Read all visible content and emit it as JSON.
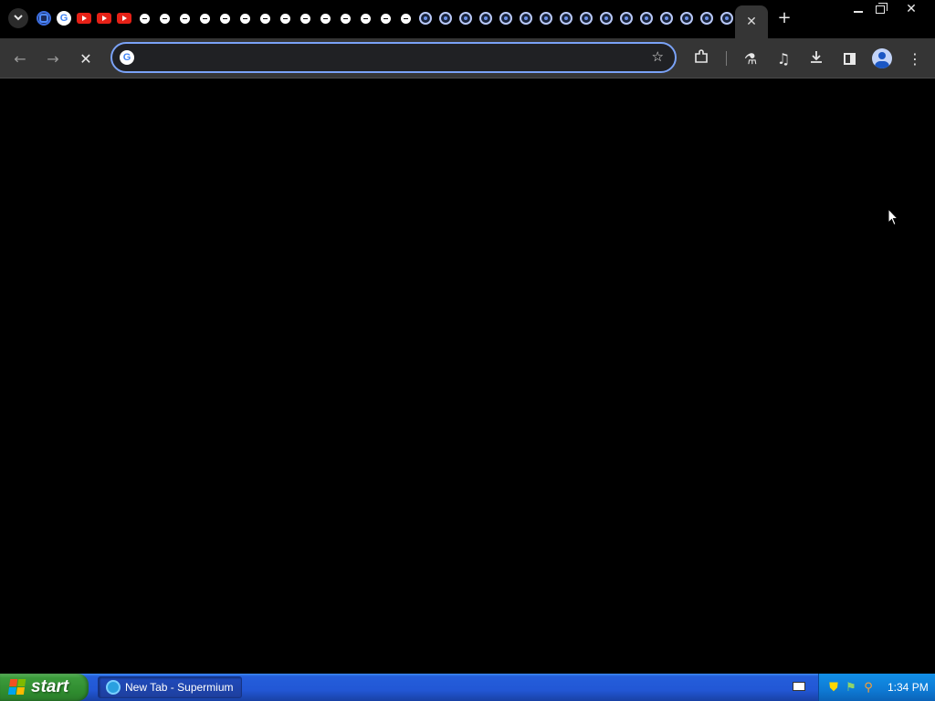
{
  "browser": {
    "tabs": [
      {
        "icon": "edge-icon"
      },
      {
        "icon": "google-icon"
      },
      {
        "icon": "youtube-icon"
      },
      {
        "icon": "youtube-icon"
      },
      {
        "icon": "youtube-icon"
      },
      {
        "icon": "globe-icon"
      },
      {
        "icon": "globe-icon"
      },
      {
        "icon": "globe-icon"
      },
      {
        "icon": "globe-icon"
      },
      {
        "icon": "globe-icon"
      },
      {
        "icon": "globe-icon"
      },
      {
        "icon": "globe-icon"
      },
      {
        "icon": "globe-icon"
      },
      {
        "icon": "globe-icon"
      },
      {
        "icon": "globe-icon"
      },
      {
        "icon": "globe-icon"
      },
      {
        "icon": "globe-icon"
      },
      {
        "icon": "globe-icon"
      },
      {
        "icon": "globe-icon"
      },
      {
        "icon": "ring-icon"
      },
      {
        "icon": "ring-icon"
      },
      {
        "icon": "ring-icon"
      },
      {
        "icon": "ring-icon"
      },
      {
        "icon": "ring-icon"
      },
      {
        "icon": "ring-icon"
      },
      {
        "icon": "ring-icon"
      },
      {
        "icon": "ring-icon"
      },
      {
        "icon": "ring-icon"
      },
      {
        "icon": "ring-icon"
      },
      {
        "icon": "ring-icon"
      },
      {
        "icon": "ring-icon"
      },
      {
        "icon": "ring-icon"
      },
      {
        "icon": "ring-icon"
      },
      {
        "icon": "ring-icon"
      },
      {
        "icon": "ring-icon"
      }
    ],
    "active_tab": {
      "close_glyph": "✕"
    },
    "new_tab_glyph": "+",
    "omnibox": {
      "value": "",
      "placeholder": "",
      "search_engine_glyph": "G"
    },
    "toolbar": {
      "back_glyph": "←",
      "forward_glyph": "→",
      "stop_glyph": "✕",
      "bookmark_glyph": "☆",
      "extensions_glyph": "⧉",
      "labs_glyph": "⚗",
      "media_glyph": "♫",
      "download_glyph": "⤓",
      "menu_glyph": "⋮"
    },
    "window_controls": {
      "close_glyph": "✕"
    }
  },
  "taskbar": {
    "start_label": "start",
    "task_items": [
      {
        "label": "New Tab - Supermium"
      }
    ],
    "tray": {
      "clock": "1:34 PM",
      "icons": [
        "shield-icon",
        "network-icon",
        "search-icon"
      ]
    }
  },
  "colors": {
    "accent": "#7aa2f7",
    "taskbar": "#245edb",
    "start_green": "#3c9b3c",
    "tray_blue": "#0e7ad4"
  }
}
